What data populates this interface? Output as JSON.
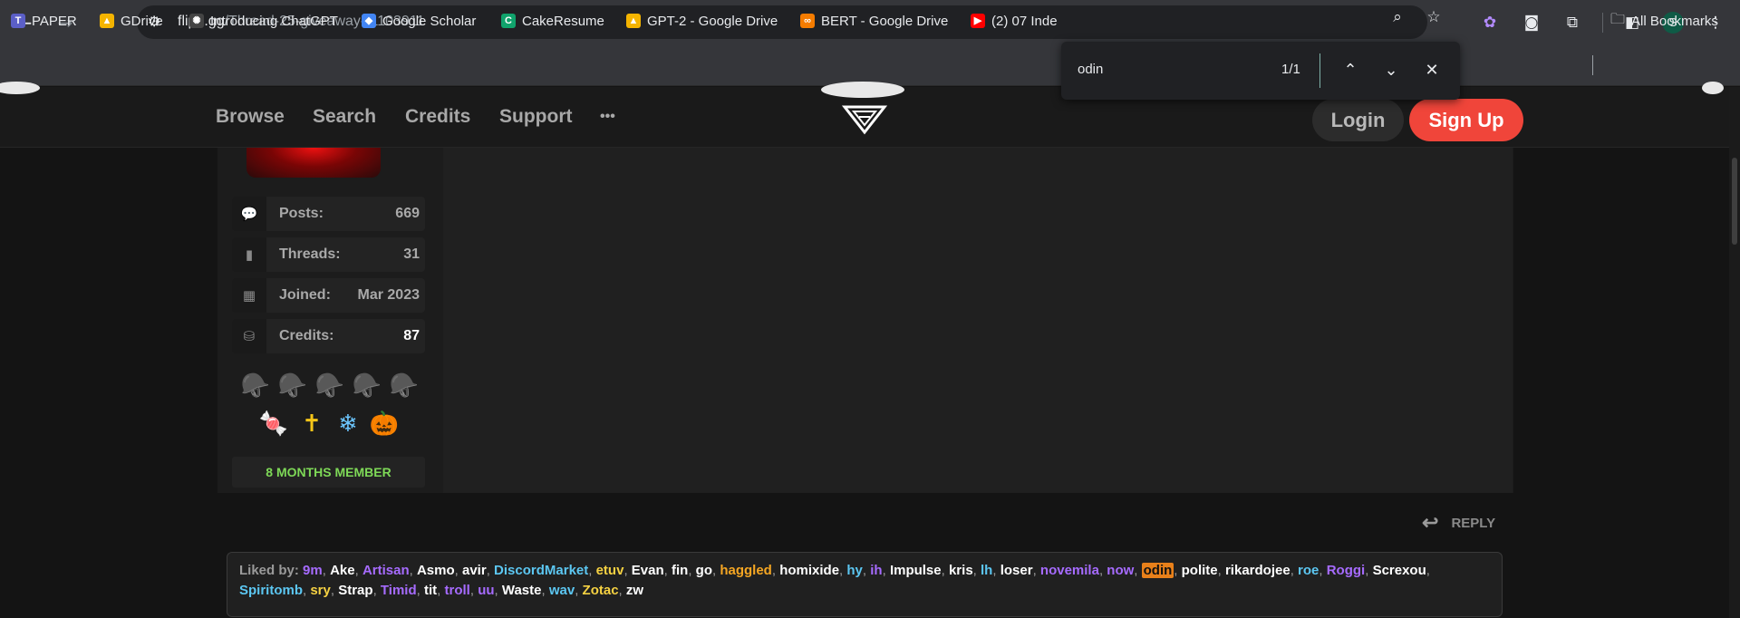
{
  "browser": {
    "url_host": "flipd.gg",
    "url_path": "/Thread-25-giveaway--1103911",
    "avatar_letter": "S",
    "bookmarks": [
      {
        "label": "PAPER",
        "icon": "teams-icon",
        "color": "#5b5fc7"
      },
      {
        "label": "GDrive",
        "icon": "google-drive-icon",
        "color": "#f4b400"
      },
      {
        "label": "Introducing ChatGPT",
        "icon": "openai-icon",
        "color": "#444"
      },
      {
        "label": "Google Scholar",
        "icon": "scholar-icon",
        "color": "#4285f4"
      },
      {
        "label": "CakeResume",
        "icon": "cakeresume-icon",
        "color": "#10a36c"
      },
      {
        "label": "GPT-2 - Google Drive",
        "icon": "google-drive-icon",
        "color": "#f4b400"
      },
      {
        "label": "BERT - Google Drive",
        "icon": "infinity-icon",
        "color": "#f57c00"
      },
      {
        "label": "(2) 07 Inde",
        "icon": "youtube-icon",
        "color": "#ff0000"
      }
    ],
    "all_bookmarks_label": "All Bookmarks"
  },
  "findbar": {
    "query": "odin",
    "count": "1/1"
  },
  "site": {
    "nav": [
      "Browse",
      "Search",
      "Credits",
      "Support"
    ],
    "more": "•••",
    "login_label": "Login",
    "signup_label": "Sign Up",
    "accent": "#f0453a"
  },
  "profile": {
    "stats": [
      {
        "label": "Posts:",
        "value": "669",
        "icon": "comments-icon"
      },
      {
        "label": "Threads:",
        "value": "31",
        "icon": "book-icon"
      },
      {
        "label": "Joined:",
        "value": "Mar 2023",
        "icon": "calendar-icon"
      },
      {
        "label": "Credits:",
        "value": "87",
        "icon": "coins-icon"
      }
    ],
    "badges_row1": [
      "🪖",
      "🪖",
      "🪖",
      "🪖",
      "🪖"
    ],
    "badges_row2": [
      "🍬",
      "✝",
      "❄",
      "🎃"
    ],
    "member_label": "8 MONTHS MEMBER"
  },
  "post": {
    "reply_label": "REPLY",
    "liked_by_label": "Liked by:",
    "likers": [
      {
        "name": "9m",
        "color": "#a66bff"
      },
      {
        "name": "Ake",
        "color": "#ffffff"
      },
      {
        "name": "Artisan",
        "color": "#a66bff"
      },
      {
        "name": "Asmo",
        "color": "#ffffff"
      },
      {
        "name": "avir",
        "color": "#ffffff"
      },
      {
        "name": "DiscordMarket",
        "color": "#5cc7f2"
      },
      {
        "name": "etuv",
        "color": "#f5d142"
      },
      {
        "name": "Evan",
        "color": "#ffffff"
      },
      {
        "name": "fin",
        "color": "#ffffff"
      },
      {
        "name": "go",
        "color": "#ffffff"
      },
      {
        "name": "haggled",
        "color": "#f5a623"
      },
      {
        "name": "homixide",
        "color": "#ffffff"
      },
      {
        "name": "hy",
        "color": "#5cc7f2"
      },
      {
        "name": "ih",
        "color": "#a66bff"
      },
      {
        "name": "Impulse",
        "color": "#ffffff"
      },
      {
        "name": "kris",
        "color": "#ffffff"
      },
      {
        "name": "lh",
        "color": "#5cc7f2"
      },
      {
        "name": "loser",
        "color": "#ffffff"
      },
      {
        "name": "novemila",
        "color": "#a66bff"
      },
      {
        "name": "now",
        "color": "#a66bff"
      },
      {
        "name": "odin",
        "color": "#111111",
        "highlight": true
      },
      {
        "name": "polite",
        "color": "#ffffff"
      },
      {
        "name": "rikardojee",
        "color": "#ffffff"
      },
      {
        "name": "roe",
        "color": "#5cc7f2"
      },
      {
        "name": "Roggi",
        "color": "#a66bff"
      },
      {
        "name": "Screxou",
        "color": "#ffffff"
      },
      {
        "name": "Spiritomb",
        "color": "#5cc7f2"
      },
      {
        "name": "sry",
        "color": "#f5d142"
      },
      {
        "name": "Strap",
        "color": "#ffffff"
      },
      {
        "name": "Timid",
        "color": "#a66bff"
      },
      {
        "name": "tit",
        "color": "#ffffff"
      },
      {
        "name": "troll",
        "color": "#a66bff"
      },
      {
        "name": "uu",
        "color": "#a66bff"
      },
      {
        "name": "Waste",
        "color": "#ffffff"
      },
      {
        "name": "wav",
        "color": "#5cc7f2"
      },
      {
        "name": "Zotac",
        "color": "#f5d142"
      },
      {
        "name": "zw",
        "color": "#ffffff"
      }
    ]
  }
}
